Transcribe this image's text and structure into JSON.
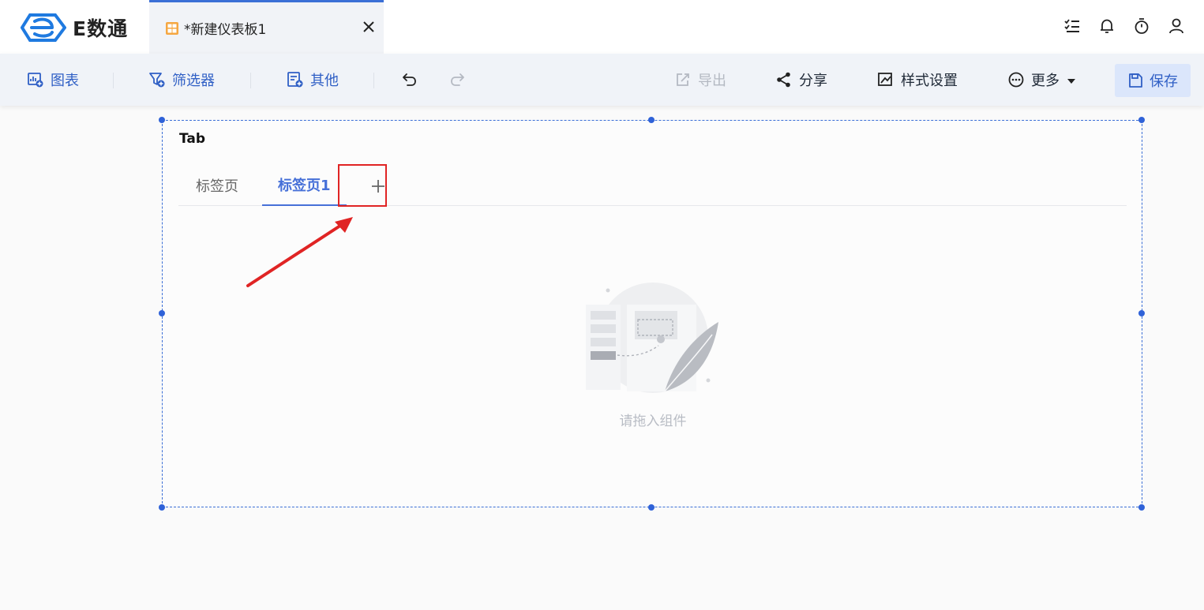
{
  "app": {
    "logo_text": "E数通"
  },
  "doc_tab": {
    "title": "*新建仪表板1"
  },
  "toolbar": {
    "chart_label": "图表",
    "filter_label": "筛选器",
    "other_label": "其他",
    "export_label": "导出",
    "share_label": "分享",
    "style_label": "样式设置",
    "more_label": "更多",
    "save_label": "保存"
  },
  "component": {
    "title": "Tab",
    "tabs": [
      {
        "label": "标签页",
        "active": false
      },
      {
        "label": "标签页1",
        "active": true
      }
    ],
    "add_tab_symbol": "+",
    "empty_text": "请拖入组件"
  },
  "colors": {
    "accent": "#3b6fd6",
    "active_tab": "#4670d8",
    "highlight": "#e02424"
  }
}
